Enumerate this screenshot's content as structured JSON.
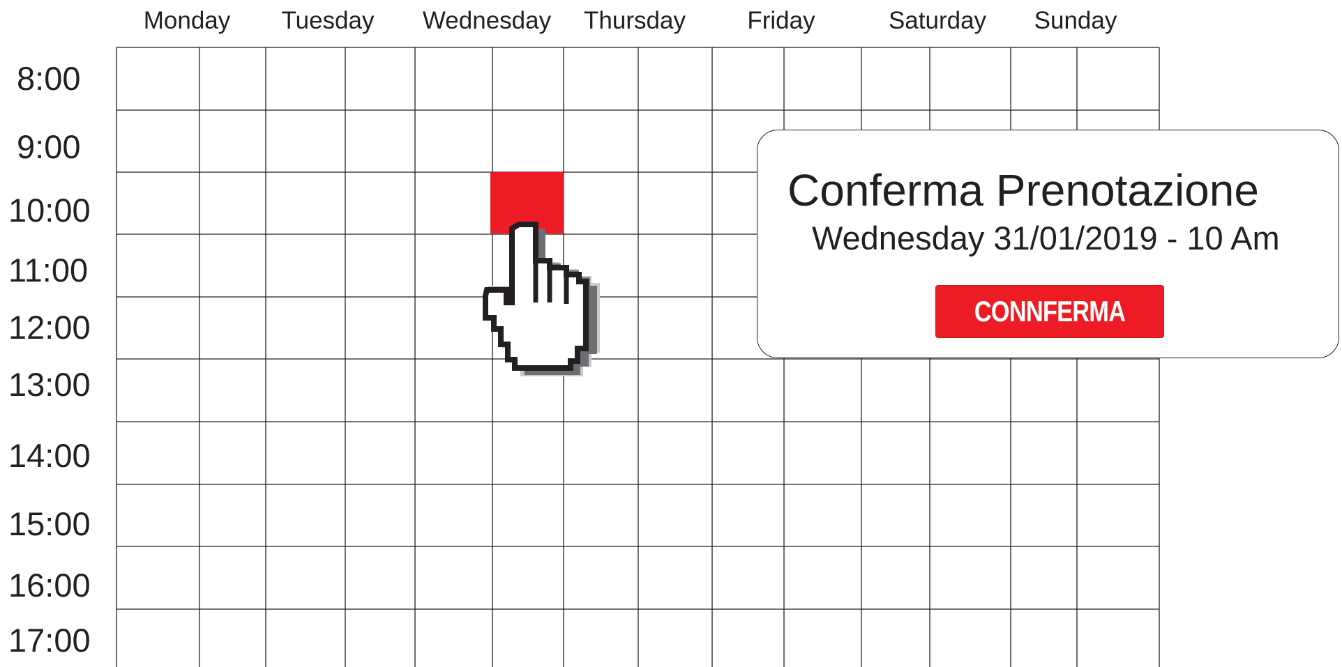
{
  "calendar": {
    "days": [
      "Monday",
      "Tuesday",
      "Wednesday",
      "Thursday",
      "Friday",
      "Saturday",
      "Sunday"
    ],
    "times": [
      "8:00",
      "9:00",
      "10:00",
      "11:00",
      "12:00",
      "13:00",
      "14:00",
      "15:00",
      "16:00",
      "17:00"
    ],
    "selected_slot": {
      "day": "Wednesday",
      "time": "10:00"
    },
    "selected_color": "#ed1c24"
  },
  "dialog": {
    "title": "Conferma Prenotazione",
    "subtitle": "Wednesday 31/01/2019 - 10 Am",
    "confirm_label": "CONNFERMA"
  },
  "cursor": {
    "icon": "pointing-hand-icon"
  }
}
